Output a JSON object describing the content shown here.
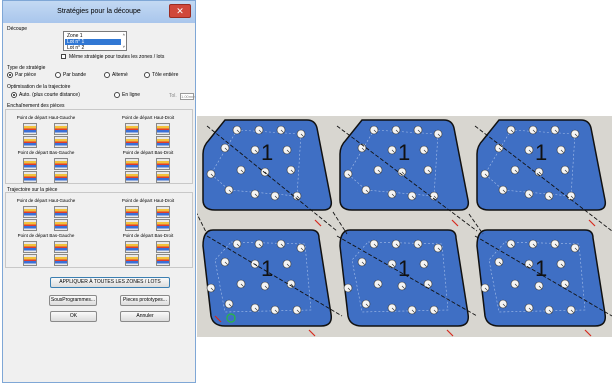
{
  "dialog": {
    "title": "Stratégies pour la découpe",
    "close_symbol": "✕",
    "decoupe": {
      "label": "Découpe",
      "items": [
        "Zone 1",
        "Lot n° 1",
        "Lot n° 2"
      ],
      "selected_index": 1,
      "same_strategy_label": "Même stratégie pour toutes les zones / lots"
    },
    "strategy_type": {
      "label": "Type de stratégie",
      "options": [
        "Par pièce",
        "Par bande",
        "Alterné",
        "Tôle entière"
      ],
      "selected_index": 0
    },
    "trajectory_optimization": {
      "label": "Optimisation de la trajectoire",
      "options": [
        "Auto. (plus courte distance)",
        "En ligne"
      ],
      "selected_index": 0,
      "tol_label": "Tol.",
      "tol_value": "1.00mm"
    },
    "chaining": {
      "label": "Enchaînement des pièces",
      "items": [
        "Point de départ Haut-Gauche",
        "Point de départ Haut-Droit",
        "Point de départ Bas-Gauche",
        "Point de départ Bas-Droit"
      ]
    },
    "trajectory_on_piece": {
      "label": "Trajectoire sur la pièce",
      "items": [
        "Point de départ Haut-Gauche",
        "Point de départ Haut-Droit",
        "Point de départ Bas-Gauche",
        "Point de départ Bas-Droit"
      ]
    },
    "buttons": {
      "apply_all": "APPLIQUER À TOUTES LES ZONES / LOTS",
      "subprograms": "SousProgrammes...",
      "prototype": "Pieces prototypes...",
      "ok": "OK",
      "cancel": "Annuler"
    }
  },
  "nesting": {
    "part_label": "1",
    "colors": {
      "part_fill": "#3f6fc4",
      "part_stroke": "#111111",
      "background": "#d8d6d0",
      "toolpath": "#111111",
      "lead_in": "#d62a1f"
    }
  }
}
